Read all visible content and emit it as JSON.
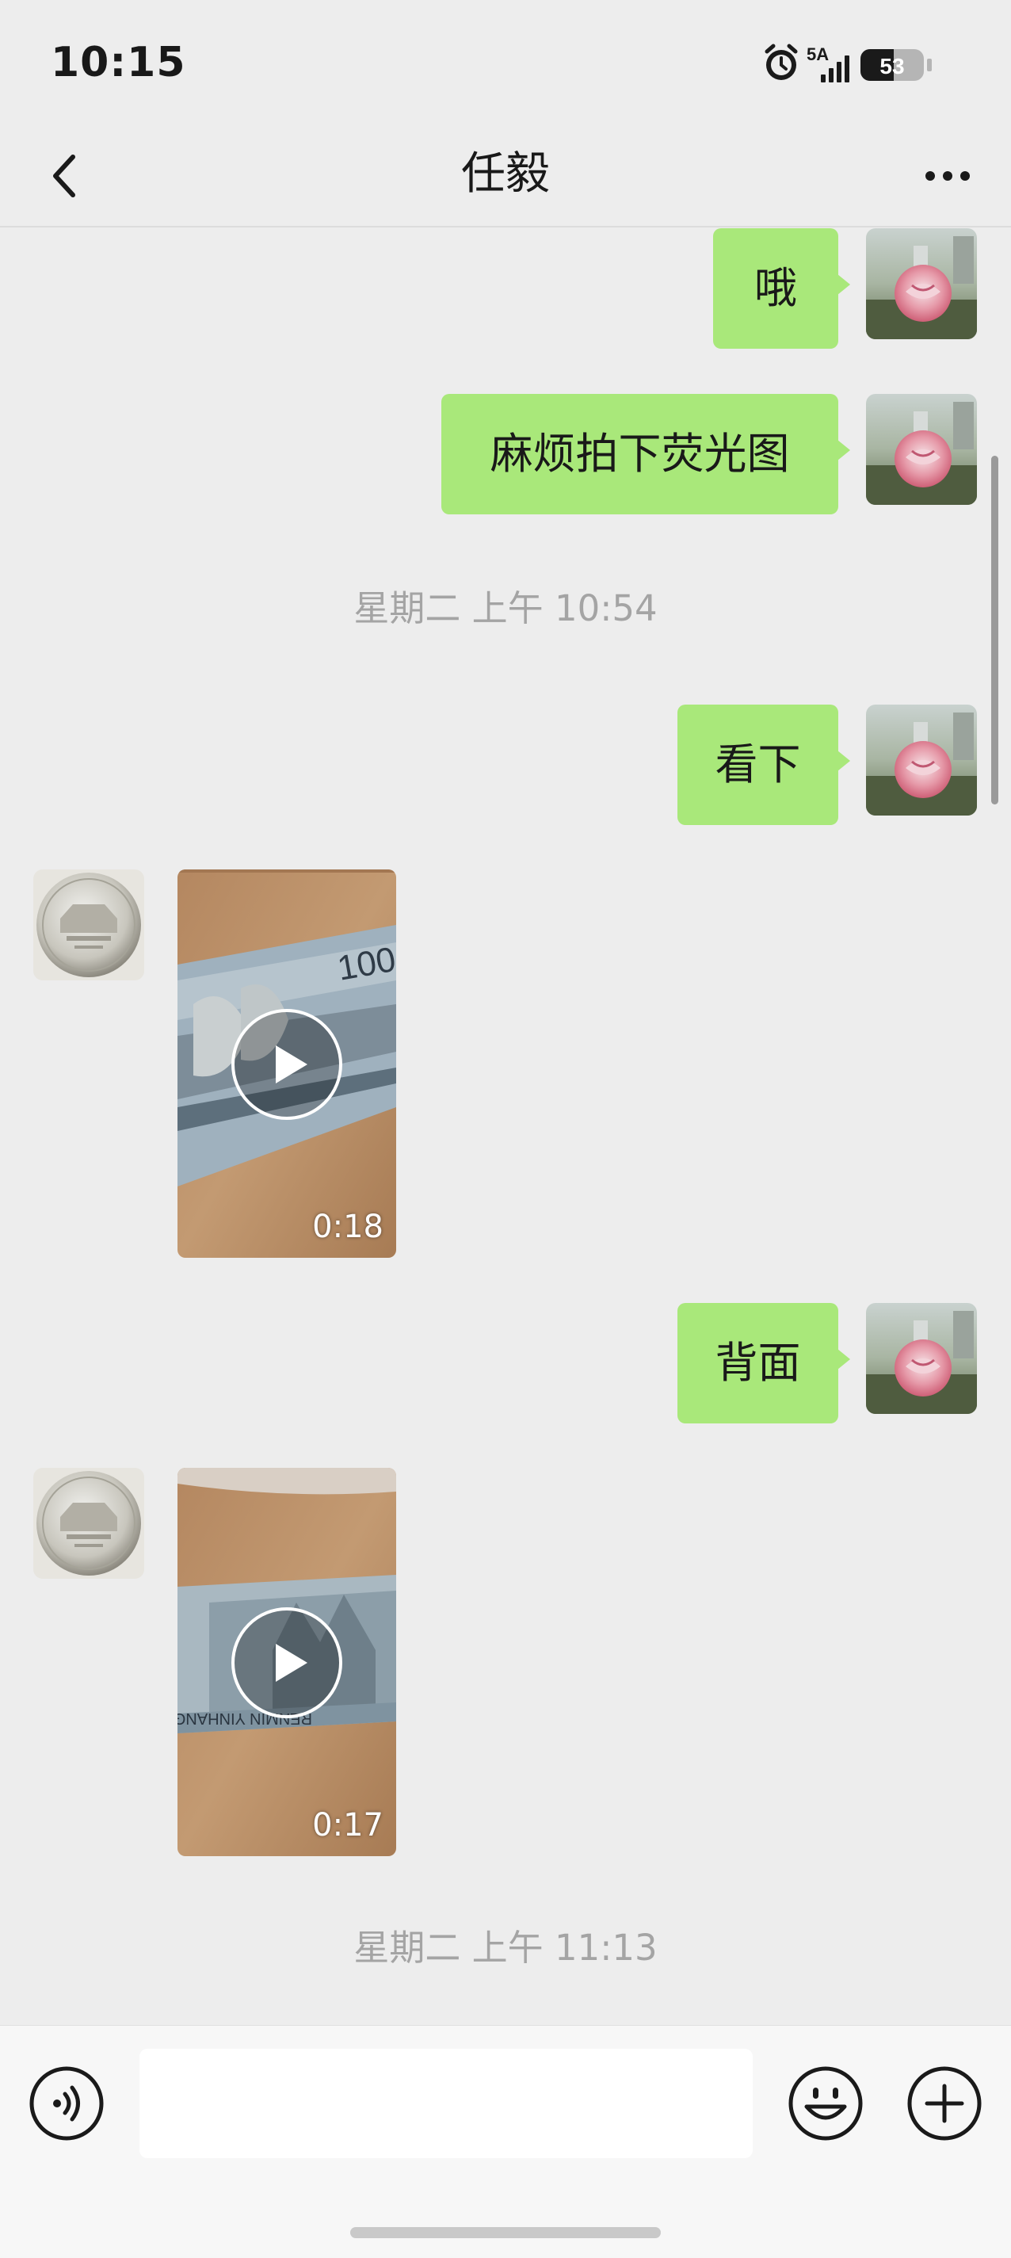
{
  "status_bar": {
    "time": "10:15",
    "network": "5A",
    "battery": "53",
    "icons": [
      "alarm-icon",
      "signal-icon",
      "battery-icon"
    ]
  },
  "nav": {
    "title": "任毅",
    "back_icon": "chevron-left-icon",
    "more_icon": "more-dots-icon"
  },
  "messages": [
    {
      "type": "text",
      "direction": "out",
      "text": "哦"
    },
    {
      "type": "text",
      "direction": "out",
      "text": "麻烦拍下荧光图"
    },
    {
      "type": "time",
      "text": "星期二 上午 10:54"
    },
    {
      "type": "text",
      "direction": "out",
      "text": "看下"
    },
    {
      "type": "video",
      "direction": "in",
      "duration": "0:18"
    },
    {
      "type": "text",
      "direction": "out",
      "text": "背面"
    },
    {
      "type": "video",
      "direction": "in",
      "duration": "0:17"
    },
    {
      "type": "time",
      "text": "星期二 上午 11:13"
    }
  ],
  "input_bar": {
    "placeholder": "",
    "value": "",
    "icons": [
      "voice-icon",
      "emoji-icon",
      "plus-icon"
    ]
  },
  "colors": {
    "background": "#ededed",
    "outgoing_bubble": "#a9e87a",
    "timestamp": "#a4a4a4"
  }
}
